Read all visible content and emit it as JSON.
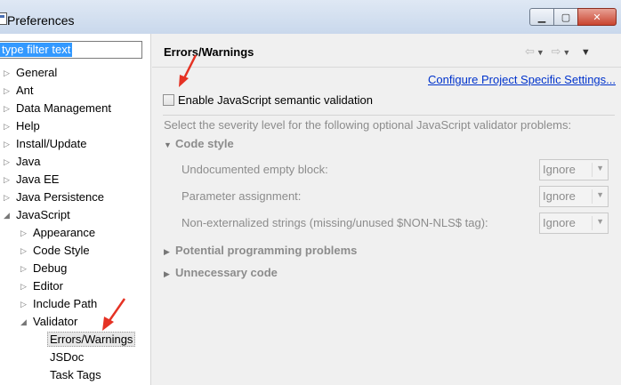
{
  "window": {
    "title": "Preferences"
  },
  "filter": {
    "placeholder": "type filter text"
  },
  "tree": {
    "items": [
      {
        "label": "General",
        "twisty": "▷"
      },
      {
        "label": "Ant",
        "twisty": "▷"
      },
      {
        "label": "Data Management",
        "twisty": "▷"
      },
      {
        "label": "Help",
        "twisty": "▷"
      },
      {
        "label": "Install/Update",
        "twisty": "▷"
      },
      {
        "label": "Java",
        "twisty": "▷"
      },
      {
        "label": "Java EE",
        "twisty": "▷"
      },
      {
        "label": "Java Persistence",
        "twisty": "▷"
      },
      {
        "label": "JavaScript",
        "twisty": "◢"
      },
      {
        "label": "Appearance",
        "twisty": "▷"
      },
      {
        "label": "Code Style",
        "twisty": "▷"
      },
      {
        "label": "Debug",
        "twisty": "▷"
      },
      {
        "label": "Editor",
        "twisty": "▷"
      },
      {
        "label": "Include Path",
        "twisty": "▷"
      },
      {
        "label": "Validator",
        "twisty": "◢"
      },
      {
        "label": "Errors/Warnings",
        "twisty": ""
      },
      {
        "label": "JSDoc",
        "twisty": ""
      },
      {
        "label": "Task Tags",
        "twisty": ""
      }
    ]
  },
  "page": {
    "title": "Errors/Warnings",
    "config_link": "Configure Project Specific Settings...",
    "enable_label": "Enable JavaScript semantic validation",
    "enable_checked": false,
    "info": "Select the severity level for the following optional JavaScript validator problems:",
    "sections": {
      "code_style": "Code style",
      "potential": "Potential programming problems",
      "unnecessary": "Unnecessary code"
    },
    "settings": [
      {
        "label": "Undocumented empty block:",
        "value": "Ignore"
      },
      {
        "label": "Parameter assignment:",
        "value": "Ignore"
      },
      {
        "label": "Non-externalized strings (missing/unused $NON-NLS$ tag):",
        "value": "Ignore"
      }
    ]
  },
  "colors": {
    "annotation": "#e53224",
    "link": "#0033cc",
    "selection": "#3399ff"
  }
}
